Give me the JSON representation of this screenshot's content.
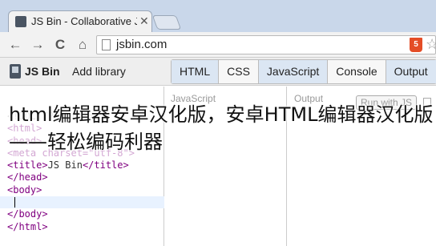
{
  "browser": {
    "tab_title": "JS Bin - Collaborative Ja",
    "tab_close": "✕",
    "url": "jsbin.com",
    "back_icon": "←",
    "forward_icon": "→",
    "reload_icon": "C",
    "home_icon": "⌂",
    "html5_badge": "5",
    "star_icon": "☆"
  },
  "jsbin": {
    "logo": "JS Bin",
    "add_library": "Add library",
    "panel_tabs": [
      "HTML",
      "CSS",
      "JavaScript",
      "Console",
      "Output"
    ]
  },
  "panes": {
    "js_label": "JavaScript",
    "output_label": "Output",
    "run_button": "Run with JS"
  },
  "code_lines": [
    "<!DOCTYPE html>",
    "<html>",
    "<head>",
    "<meta charset=\"utf-8\">",
    "<title>JS Bin</title>",
    "</head>",
    "<body>",
    "",
    "</body>",
    "</html>"
  ],
  "title_text": "JS Bin",
  "caption": "html编辑器安卓汉化版，安卓HTML编辑器汉化版——轻松编码利器",
  "colors": {
    "tabstrip": "#c9d7ea",
    "active_tab": "#dbe6f3",
    "tag": "#800080"
  }
}
